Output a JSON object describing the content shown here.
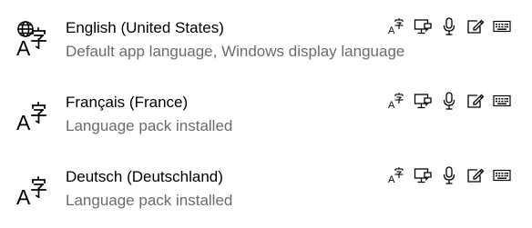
{
  "languages": [
    {
      "name": "English (United States)",
      "description": "Default app language, Windows display language",
      "glyph": "globe-language-icon",
      "features": [
        "language-pack-icon",
        "text-to-speech-icon",
        "speech-recognition-icon",
        "handwriting-icon",
        "keyboard-icon"
      ]
    },
    {
      "name": "Français (France)",
      "description": "Language pack installed",
      "glyph": "language-icon",
      "features": [
        "language-pack-icon",
        "text-to-speech-icon",
        "speech-recognition-icon",
        "handwriting-icon",
        "keyboard-icon"
      ]
    },
    {
      "name": "Deutsch (Deutschland)",
      "description": "Language pack installed",
      "glyph": "language-icon",
      "features": [
        "language-pack-icon",
        "text-to-speech-icon",
        "speech-recognition-icon",
        "handwriting-icon",
        "keyboard-icon"
      ]
    }
  ],
  "colors": {
    "primary_text": "#000000",
    "secondary_text": "#6b6b6b",
    "background": "#ffffff"
  }
}
